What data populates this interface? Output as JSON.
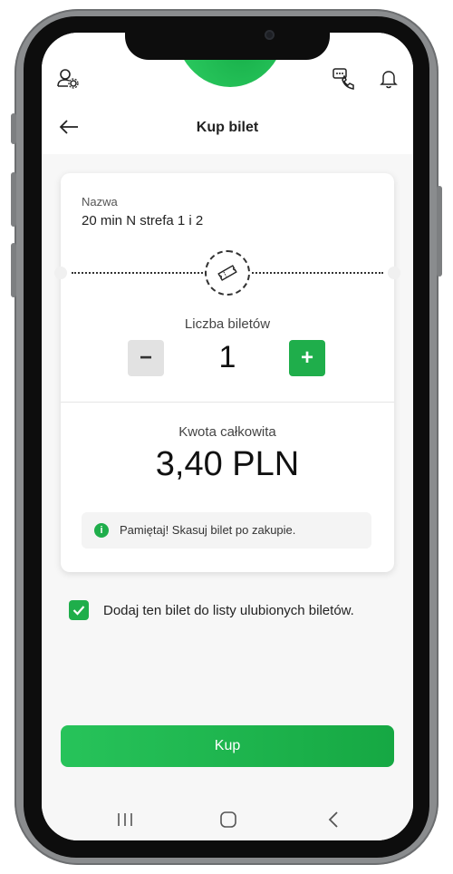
{
  "header": {
    "profile_settings_icon": "user-settings-icon",
    "support_icon": "chat-phone-icon",
    "notifications_icon": "bell-icon"
  },
  "titlebar": {
    "back_icon": "arrow-left-icon",
    "title": "Kup bilet"
  },
  "ticket": {
    "name_label": "Nazwa",
    "name_value": "20 min N strefa 1 i 2",
    "count_label": "Liczba biletów",
    "count_value": "1",
    "minus_label": "−",
    "plus_label": "+",
    "total_label": "Kwota całkowita",
    "total_value": "3,40 PLN",
    "info_icon_text": "i",
    "info_text": "Pamiętaj! Skasuj bilet po zakupie."
  },
  "favorite": {
    "checked": true,
    "label": "Dodaj ten bilet do listy ulubionych biletów."
  },
  "actions": {
    "buy_label": "Kup"
  },
  "colors": {
    "accent": "#1fae4b",
    "background": "#f7f7f7"
  }
}
